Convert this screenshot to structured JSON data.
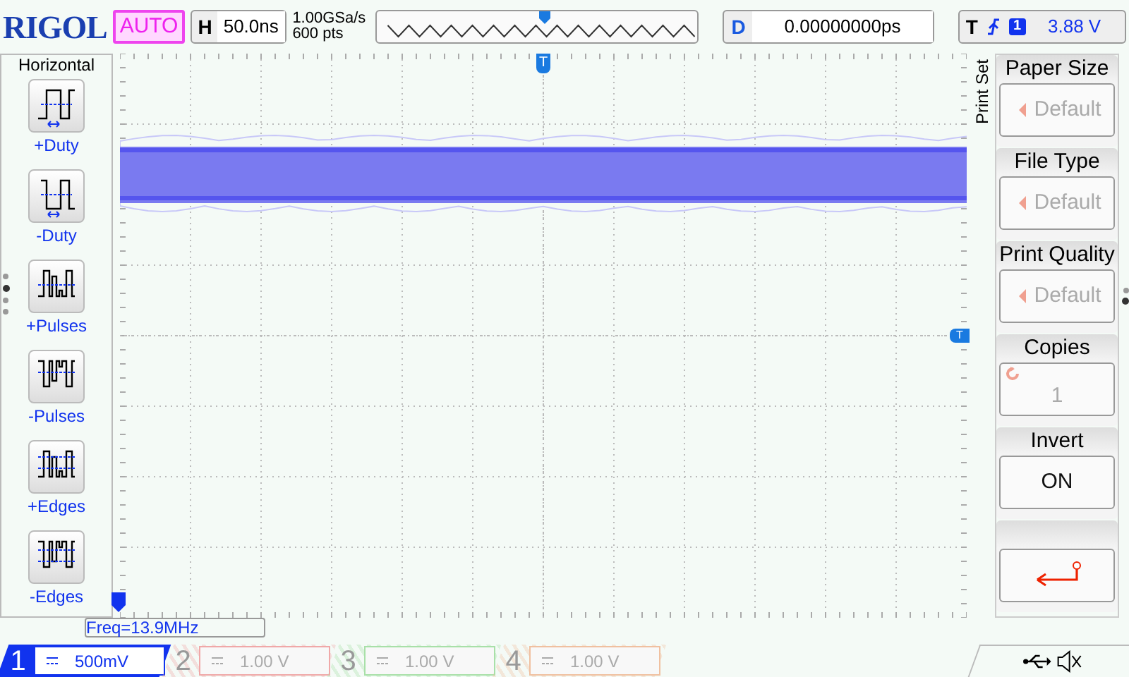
{
  "header": {
    "brand": "RIGOL",
    "mode": "AUTO",
    "timebase": {
      "label": "H",
      "value": "50.0ns"
    },
    "sample_rate": "1.00GSa/s",
    "memory_depth": "600 pts",
    "delay": {
      "label": "D",
      "value": "0.00000000ps"
    },
    "trigger": {
      "label": "T",
      "channel": "1",
      "level": "3.88 V"
    }
  },
  "left_menu": {
    "title": "Horizontal",
    "items": [
      {
        "label": "+Duty",
        "kind": "pos-duty"
      },
      {
        "label": "-Duty",
        "kind": "neg-duty"
      },
      {
        "label": "+Pulses",
        "kind": "pos-pulses"
      },
      {
        "label": "-Pulses",
        "kind": "neg-pulses"
      },
      {
        "label": "+Edges",
        "kind": "pos-edges"
      },
      {
        "label": "-Edges",
        "kind": "neg-edges"
      }
    ],
    "pages": [
      {
        "selected": false
      },
      {
        "selected": true
      },
      {
        "selected": false
      },
      {
        "selected": false
      }
    ]
  },
  "scope": {
    "trigger_position_marker": "T",
    "trigger_level_marker": "T",
    "measurement": "Freq=13.9MHz"
  },
  "right_menu": {
    "tab": "Print Set",
    "items": [
      {
        "kind": "choice",
        "title": "Paper Size",
        "value": "Default",
        "disabled": true
      },
      {
        "kind": "choice",
        "title": "File Type",
        "value": "Default",
        "disabled": true
      },
      {
        "kind": "choice",
        "title": "Print Quality",
        "value": "Default",
        "disabled": true
      },
      {
        "kind": "knob",
        "title": "Copies",
        "value": "1",
        "disabled": true
      },
      {
        "kind": "toggle",
        "title": "Invert",
        "value": "ON",
        "disabled": false
      },
      {
        "kind": "back"
      }
    ],
    "pages": [
      {
        "selected": false
      },
      {
        "selected": true
      }
    ]
  },
  "channels": [
    {
      "number": "1",
      "scale": "500mV",
      "on": true,
      "color": "#1133ee"
    },
    {
      "number": "2",
      "scale": "1.00 V",
      "on": false,
      "color": "#f0a8a8"
    },
    {
      "number": "3",
      "scale": "1.00 V",
      "on": false,
      "color": "#a8e0a8"
    },
    {
      "number": "4",
      "scale": "1.00 V",
      "on": false,
      "color": "#f0c0a0"
    }
  ]
}
